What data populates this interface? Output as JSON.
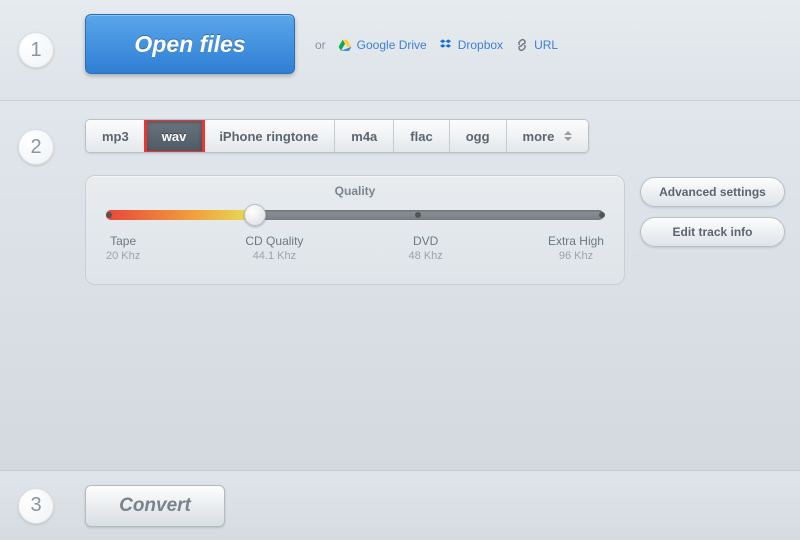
{
  "steps": {
    "s1": "1",
    "s2": "2",
    "s3": "3"
  },
  "open_files_label": "Open files",
  "cloud": {
    "or": "or",
    "google_drive": "Google Drive",
    "dropbox": "Dropbox",
    "url": "URL"
  },
  "formats": {
    "mp3": "mp3",
    "wav": "wav",
    "iphone": "iPhone ringtone",
    "m4a": "m4a",
    "flac": "flac",
    "ogg": "ogg",
    "more": "more",
    "active": "wav"
  },
  "quality": {
    "title": "Quality",
    "stops": [
      {
        "label": "Tape",
        "sub": "20 Khz"
      },
      {
        "label": "CD Quality",
        "sub": "44.1 Khz"
      },
      {
        "label": "DVD",
        "sub": "48 Khz"
      },
      {
        "label": "Extra High",
        "sub": "96 Khz"
      }
    ],
    "selected_index": 1
  },
  "side": {
    "advanced": "Advanced settings",
    "edit_track": "Edit track info"
  },
  "convert_label": "Convert"
}
